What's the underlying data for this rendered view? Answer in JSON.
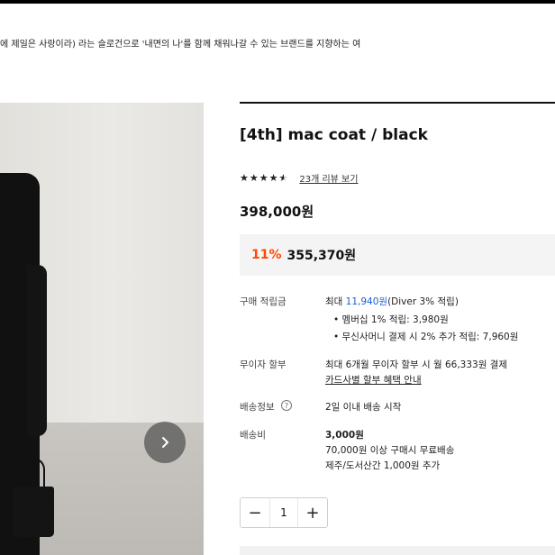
{
  "banner": {
    "text": "에 제일은 사랑이라) 라는 슬로건으로 '내면의 나'를 함께 채워나갈 수 있는 브랜드를 지향하는 여"
  },
  "product": {
    "title": "[4th] mac coat / black",
    "rating": {
      "stars": 4.5,
      "max": 5,
      "review_link": "23개 리뷰 보기"
    },
    "price": "398,000원",
    "sale": {
      "percent": "11%",
      "price": "355,370원"
    }
  },
  "points": {
    "label": "구매 적립금",
    "prefix": "최대 ",
    "amount": "11,940원",
    "suffix": "(Diver 3% 적립)",
    "bullets": [
      "멤버십 1% 적립: 3,980원",
      "무신사머니 결제 시 2% 추가 적립: 7,960원"
    ]
  },
  "installment": {
    "label": "무이자 할부",
    "text": "최대 6개월 무이자 할부 시 월 66,333원 결제",
    "link": "카드사별 할부 혜택 안내"
  },
  "shipping_info": {
    "label": "배송정보",
    "info_icon": "?",
    "text": "2일 이내 배송 시작"
  },
  "shipping_fee": {
    "label": "배송비",
    "amount": "3,000원",
    "lines": [
      "70,000원 이상 구매시 무료배송",
      "제주/도서산간 1,000원 추가"
    ]
  },
  "quantity": {
    "minus": "−",
    "value": "1",
    "plus": "+"
  },
  "icons": {
    "next": "chevron-right-icon",
    "info": "question-circle-icon"
  },
  "colors": {
    "accent": "#ff4800",
    "link_blue": "#1a5fd8",
    "sale_bg": "#f4f4f4"
  }
}
